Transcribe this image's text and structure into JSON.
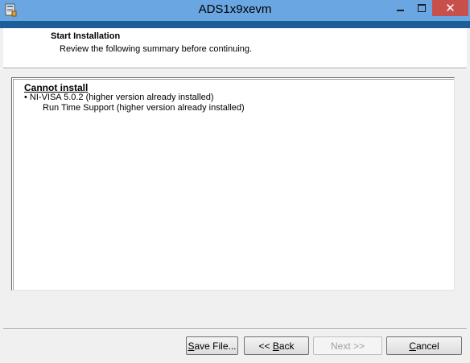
{
  "window": {
    "title": "ADS1x9xevm",
    "close_glyph": "✕"
  },
  "header": {
    "title": "Start Installation",
    "subtitle": "Review the following summary before continuing."
  },
  "summary": {
    "heading": "Cannot install",
    "items": [
      "• NI-VISA 5.0.2 (higher version already installed)",
      "Run Time Support (higher version already installed)"
    ]
  },
  "buttons": {
    "save_prefix": "S",
    "save_rest": "ave File...",
    "back_prefix": "<< ",
    "back_mnemonic": "B",
    "back_rest": "ack",
    "next_label": "Next >>",
    "cancel_mnemonic": "C",
    "cancel_rest": "ancel"
  },
  "colors": {
    "titlebar": "#6aa6e2",
    "accent_strip": "#1b5e98",
    "close_button": "#c7504b",
    "window_bg": "#f0f0f0"
  }
}
